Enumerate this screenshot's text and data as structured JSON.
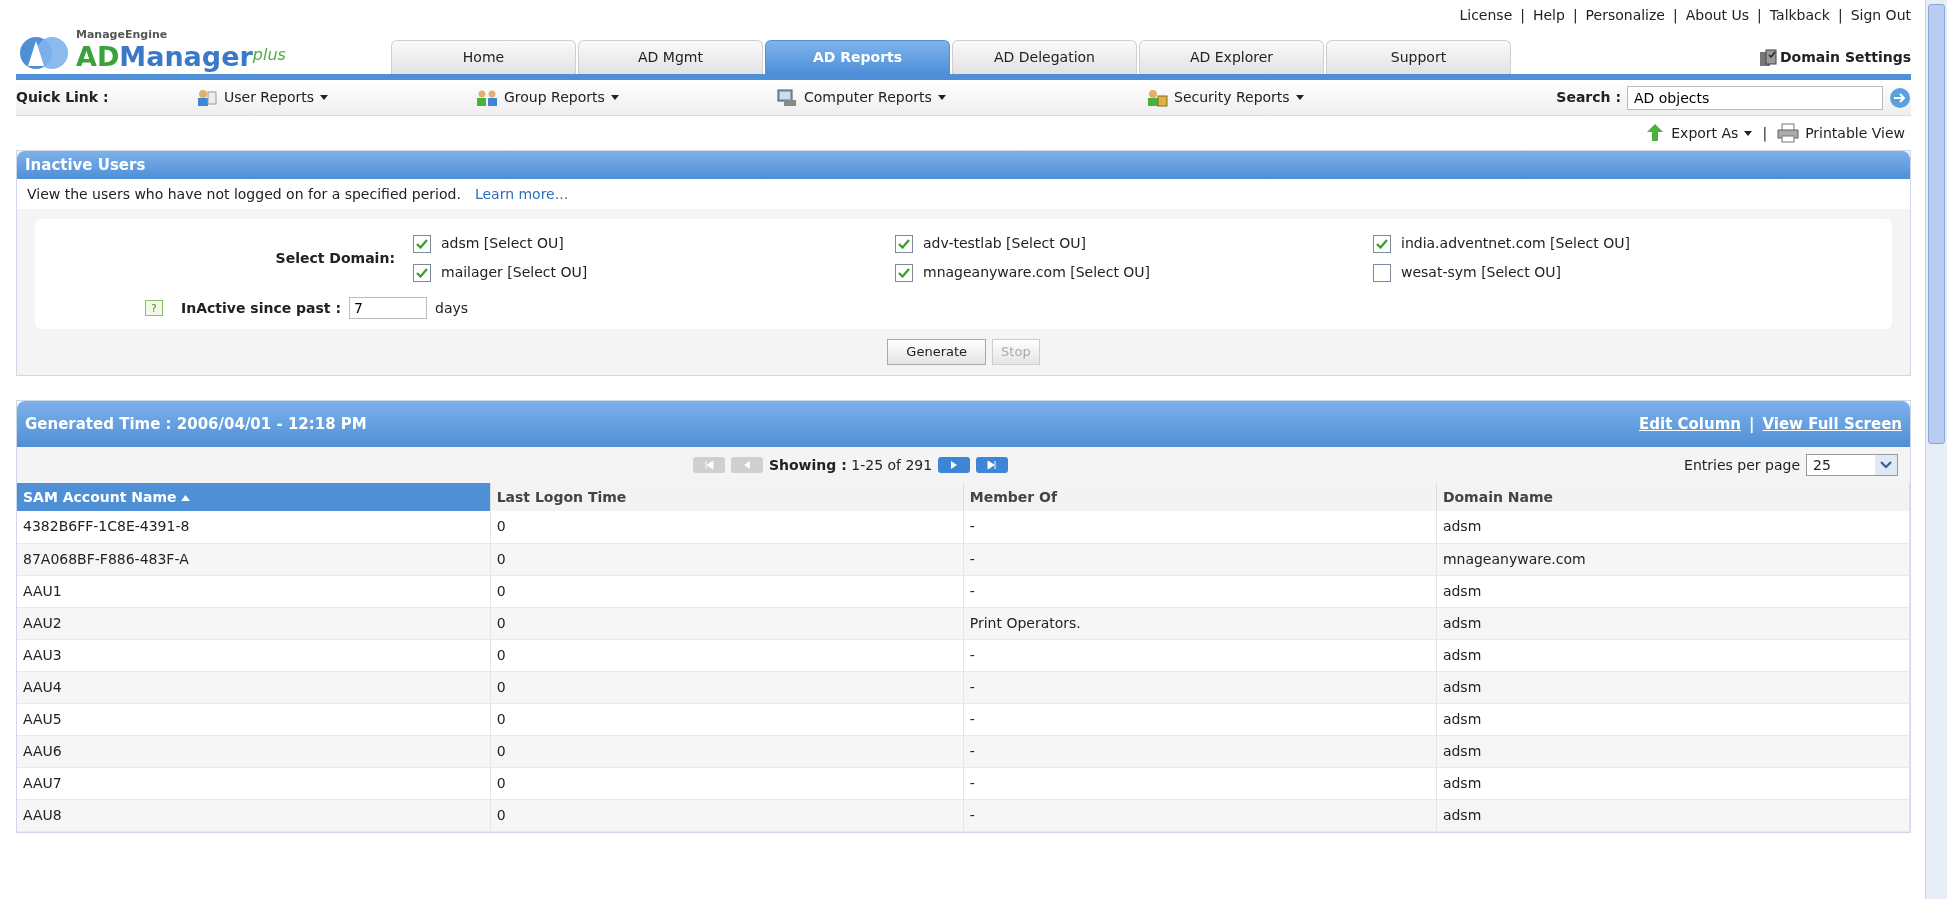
{
  "top_links": {
    "items": [
      "License",
      "Help",
      "Personalize",
      "About Us",
      "Talkback",
      "Sign Out"
    ],
    "separator": "|"
  },
  "logo": {
    "vendor": "ManageEngine",
    "prefix": "AD",
    "product": "Manager",
    "suffix": "plus"
  },
  "tabs": [
    {
      "label": "Home",
      "selected": false
    },
    {
      "label": "AD Mgmt",
      "selected": false
    },
    {
      "label": "AD Reports",
      "selected": true
    },
    {
      "label": "AD Delegation",
      "selected": false
    },
    {
      "label": "AD Explorer",
      "selected": false
    },
    {
      "label": "Support",
      "selected": false
    }
  ],
  "domain_settings": "Domain Settings",
  "quick_links": {
    "label": "Quick Link :",
    "items": [
      {
        "label": "User Reports",
        "kind": "user"
      },
      {
        "label": "Group Reports",
        "kind": "group"
      },
      {
        "label": "Computer Reports",
        "kind": "computer"
      },
      {
        "label": "Security Reports",
        "kind": "security"
      }
    ]
  },
  "search": {
    "label": "Search :",
    "value": "AD objects"
  },
  "actions": {
    "export": "Export As",
    "separator": "|",
    "printable": "Printable View"
  },
  "report": {
    "title": "Inactive Users",
    "description": "View the users who have not logged on for a specified period.",
    "learn_more": "Learn more...",
    "domain_label": "Select Domain:",
    "domains": [
      {
        "label": "adsm [Select OU]",
        "checked": true
      },
      {
        "label": "adv-testlab [Select OU]",
        "checked": true
      },
      {
        "label": "india.adventnet.com [Select OU]",
        "checked": true
      },
      {
        "label": "mailager [Select OU]",
        "checked": true
      },
      {
        "label": "mnageanyware.com [Select OU]",
        "checked": true
      },
      {
        "label": "wesat-sym [Select OU]",
        "checked": false
      }
    ],
    "help": "?",
    "since_label": "InActive since past :",
    "since_value": "7",
    "since_unit": "days",
    "buttons": [
      {
        "label": "Generate",
        "disabled": false
      },
      {
        "label": "Stop",
        "disabled": true
      }
    ]
  },
  "results": {
    "generated": "Generated Time : 2006/04/01 - 12:18 PM",
    "links": [
      "Edit Column",
      "View Full Screen"
    ],
    "link_separator": "|",
    "pager": {
      "buttons": [
        {
          "kind": "first",
          "disabled": true
        },
        {
          "kind": "prev",
          "disabled": true
        },
        {
          "kind": "next",
          "disabled": false
        },
        {
          "kind": "last",
          "disabled": false
        }
      ],
      "showing": "**Showing :** 1-25 of 291"
    },
    "entries_label": "Entries per page",
    "entries_value": "25",
    "columns": [
      {
        "label": "SAM Account Name",
        "sorted": true
      },
      {
        "label": "Last Logon Time",
        "sorted": false
      },
      {
        "label": "Member Of",
        "sorted": false
      },
      {
        "label": "Domain Name",
        "sorted": false
      }
    ],
    "rows": [
      [
        "4382B6FF-1C8E-4391-8",
        "0",
        "-",
        "adsm"
      ],
      [
        "87A068BF-F886-483F-A",
        "0",
        "-",
        "mnageanyware.com"
      ],
      [
        "AAU1",
        "0",
        "-",
        "adsm"
      ],
      [
        "AAU2",
        "0",
        "Print Operators.",
        "adsm"
      ],
      [
        "AAU3",
        "0",
        "-",
        "adsm"
      ],
      [
        "AAU4",
        "0",
        "-",
        "adsm"
      ],
      [
        "AAU5",
        "0",
        "-",
        "adsm"
      ],
      [
        "AAU6",
        "0",
        "-",
        "adsm"
      ],
      [
        "AAU7",
        "0",
        "-",
        "adsm"
      ],
      [
        "AAU8",
        "0",
        "-",
        "adsm"
      ]
    ]
  }
}
